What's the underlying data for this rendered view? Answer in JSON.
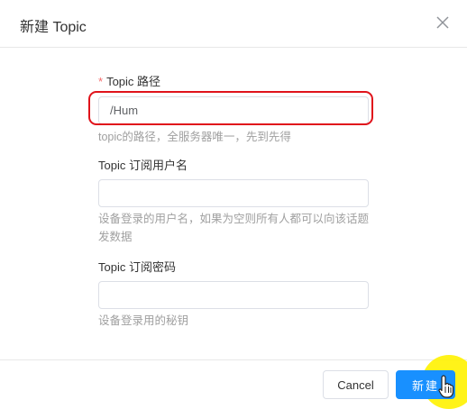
{
  "dialog": {
    "title": "新建 Topic",
    "close_icon": "close-icon"
  },
  "form": {
    "path": {
      "required_mark": "*",
      "label": "Topic 路径",
      "value": "/Hum",
      "hint": "topic的路径，全服务器唯一，先到先得"
    },
    "username": {
      "label": "Topic 订阅用户名",
      "value": "",
      "hint": "设备登录的用户名，如果为空则所有人都可以向该话题发数据"
    },
    "password": {
      "label": "Topic 订阅密码",
      "value": "",
      "hint": "设备登录用的秘钥"
    }
  },
  "footer": {
    "cancel_label": "Cancel",
    "create_label": "新建"
  },
  "colors": {
    "primary": "#1890ff",
    "highlight": "#e0131b",
    "cursor_halo": "#fff200"
  }
}
